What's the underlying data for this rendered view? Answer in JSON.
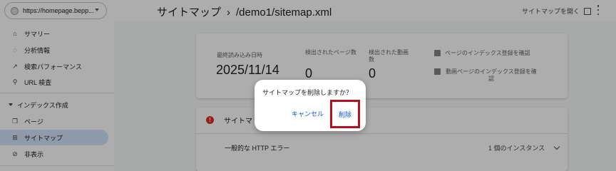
{
  "sidebar": {
    "property": "https://homepage.bepp...",
    "items": [
      {
        "label": "サマリー",
        "icon": "home-icon"
      },
      {
        "label": "分析情報",
        "icon": "lightbulb-icon"
      },
      {
        "label": "検索パフォーマンス",
        "icon": "trending-up-icon"
      },
      {
        "label": "URL 検査",
        "icon": "search-icon"
      }
    ],
    "section": "インデックス作成",
    "section_items": [
      {
        "label": "ページ",
        "icon": "pages-icon"
      },
      {
        "label": "サイトマップ",
        "icon": "sitemap-icon"
      },
      {
        "label": "非表示",
        "icon": "visibility-off-icon"
      }
    ]
  },
  "header": {
    "title": "サイトマップ",
    "subtitle": "/demo1/sitemap.xml",
    "open_link": "サイトマップを開く"
  },
  "summary": {
    "last_read_label": "最終読み込み日時",
    "last_read_value": "2025/11/14",
    "pages_label": "検出されたページ数",
    "pages_value": "0",
    "videos_label": "検出された動画数",
    "videos_value": "0",
    "link_pages": "ページのインデックス登録を確認",
    "link_videos": "動画ページのインデックス登録を確認"
  },
  "errors": {
    "title": "サイトマ",
    "type": "一般的な HTTP エラー",
    "count": "1 個のインスタンス"
  },
  "dialog": {
    "message": "サイトマップを削除しますか？",
    "cancel": "キャンセル",
    "delete": "削除"
  },
  "colors": {
    "accent": "#0b57d0",
    "active_nav": "#d3e3fd",
    "error": "#d93025",
    "highlight_border": "#b3121a"
  }
}
